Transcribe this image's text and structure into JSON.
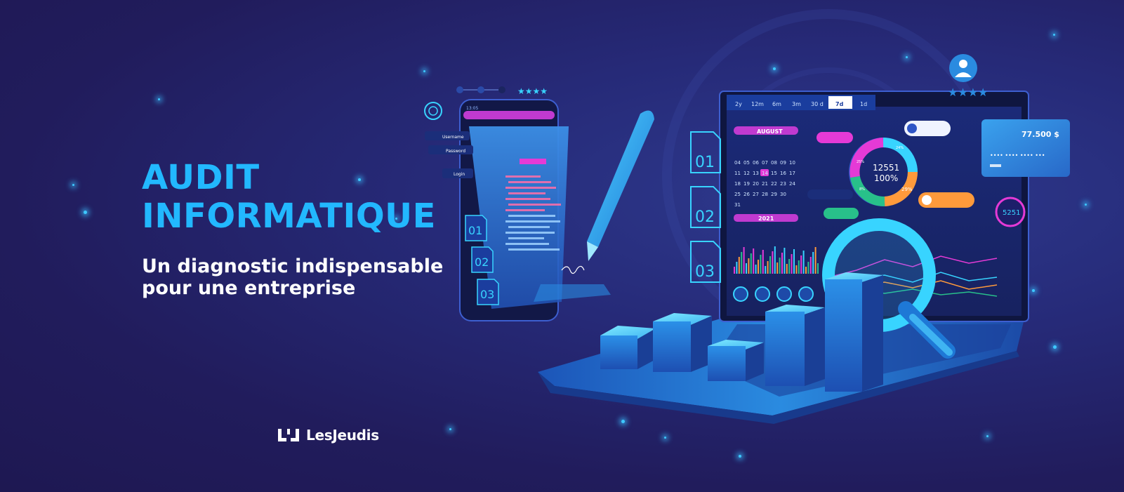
{
  "headline": {
    "line1": "AUDIT",
    "line2": "INFORMATIQUE"
  },
  "subheadline": {
    "line1": "Un diagnostic indispensable",
    "line2": "pour une entreprise"
  },
  "brand": {
    "name": "LesJeudis"
  },
  "illustration": {
    "time_tabs": [
      "2y",
      "12m",
      "6m",
      "3m",
      "30 d",
      "7d",
      "1d"
    ],
    "active_tab": "7d",
    "calendar_month": "AUGUST",
    "calendar_year": "2021",
    "calendar_highlight": "14",
    "calendar_rows": [
      [
        "04",
        "05",
        "06",
        "07",
        "08",
        "09",
        "10"
      ],
      [
        "11",
        "12",
        "13",
        "14",
        "15",
        "16",
        "17"
      ],
      [
        "18",
        "19",
        "20",
        "21",
        "22",
        "23",
        "24"
      ],
      [
        "25",
        "26",
        "27",
        "28",
        "29",
        "30",
        ""
      ],
      [
        "31",
        "",
        "",
        "",
        "",
        "",
        ""
      ]
    ],
    "donut_value": "12551",
    "donut_percent": "100%",
    "donut_labels": [
      "24%",
      "29%",
      "25%",
      "8%"
    ],
    "card_amount": "77.500 $",
    "card_dots": "•••• •••• •••• •••",
    "badge_number": "5251",
    "side_tabs": [
      "01",
      "02",
      "03"
    ],
    "phone_tabs": [
      "01",
      "02",
      "03"
    ],
    "login_fields": [
      "Username",
      "Password"
    ],
    "login_button": "Login",
    "time": "13:05",
    "stars": "★★★★",
    "colors": {
      "accent": "#22b8ff",
      "background": "#221f5e",
      "neon_cyan": "#38e0ff",
      "magenta": "#e53ad6",
      "orange": "#ff9a3b"
    }
  }
}
